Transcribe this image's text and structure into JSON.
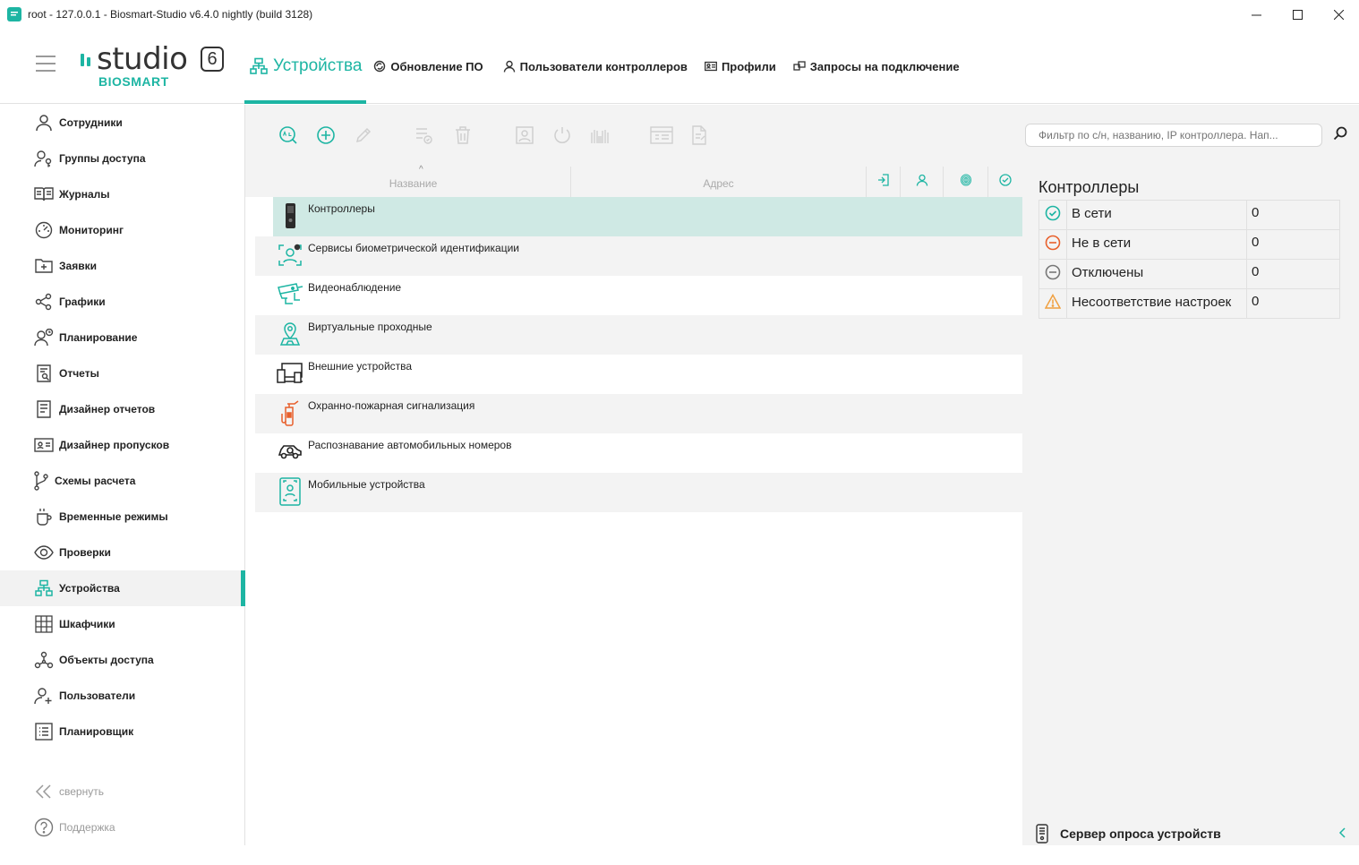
{
  "window": {
    "title": "root - 127.0.0.1 - Biosmart-Studio v6.4.0 nightly (build 3128)",
    "minimize": "—",
    "maximize": "☐",
    "close": "✕"
  },
  "logo": {
    "word": "studio",
    "number": "6",
    "brand": "BIOSMART"
  },
  "topnav": {
    "tabs": [
      {
        "label": "Устройства",
        "icon": "devices-icon",
        "active": true
      },
      {
        "label": "Обновление ПО",
        "icon": "update-icon"
      },
      {
        "label": "Пользователи контроллеров",
        "icon": "user-icon"
      },
      {
        "label": "Профили",
        "icon": "id-card-icon"
      },
      {
        "label": "Запросы на подключение",
        "icon": "link-icon"
      }
    ]
  },
  "sidebar": {
    "items": [
      {
        "label": "Сотрудники",
        "icon": "person-icon"
      },
      {
        "label": "Группы доступа",
        "icon": "group-access-icon"
      },
      {
        "label": "Журналы",
        "icon": "book-icon"
      },
      {
        "label": "Мониторинг",
        "icon": "gauge-icon"
      },
      {
        "label": "Заявки",
        "icon": "folder-plus-icon"
      },
      {
        "label": "Графики",
        "icon": "share-icon"
      },
      {
        "label": "Планирование",
        "icon": "person-clock-icon"
      },
      {
        "label": "Отчеты",
        "icon": "report-icon"
      },
      {
        "label": "Дизайнер отчетов",
        "icon": "report-designer-icon"
      },
      {
        "label": "Дизайнер пропусков",
        "icon": "badge-designer-icon"
      },
      {
        "label": "Схемы расчета",
        "icon": "branch-icon"
      },
      {
        "label": "Временные режимы",
        "icon": "cup-icon"
      },
      {
        "label": "Проверки",
        "icon": "eye-icon"
      },
      {
        "label": "Устройства",
        "icon": "devices-icon",
        "active": true
      },
      {
        "label": "Шкафчики",
        "icon": "lockers-icon"
      },
      {
        "label": "Объекты доступа",
        "icon": "nodes-icon"
      },
      {
        "label": "Пользователи",
        "icon": "user-add-icon"
      },
      {
        "label": "Планировщик",
        "icon": "list-icon"
      }
    ],
    "collapse": "свернуть",
    "support": "Поддержка"
  },
  "table": {
    "col_name": "Название",
    "col_address": "Адрес",
    "sort_glyph": "^",
    "rows": [
      {
        "label": "Контроллеры",
        "icon": "controller-icon"
      },
      {
        "label": "Сервисы биометрической идентификации",
        "icon": "face-recognition-icon"
      },
      {
        "label": "Видеонаблюдение",
        "icon": "cctv-icon"
      },
      {
        "label": "Виртуальные проходные",
        "icon": "virtual-checkpoint-icon"
      },
      {
        "label": "Внешние устройства",
        "icon": "external-devices-icon"
      },
      {
        "label": "Охранно-пожарная сигнализация",
        "icon": "fire-alarm-icon"
      },
      {
        "label": "Распознавание автомобильных номеров",
        "icon": "car-plate-icon"
      },
      {
        "label": "Мобильные устройства",
        "icon": "mobile-device-icon"
      }
    ]
  },
  "filter": {
    "placeholder": "Фильтр по с/н, названию, IP контроллера. Нап..."
  },
  "panel": {
    "title": "Контроллеры",
    "stats": [
      {
        "label": "В сети",
        "value": "0",
        "icon": "check-circle-icon",
        "color": "#1db5a3"
      },
      {
        "label": "Не в сети",
        "value": "0",
        "icon": "minus-circle-icon",
        "color": "#e8602c"
      },
      {
        "label": "Отключены",
        "value": "0",
        "icon": "minus-circle-gray-icon",
        "color": "#777777"
      },
      {
        "label": "Несоответствие настроек",
        "value": "0",
        "icon": "warning-icon",
        "color": "#f0a040"
      }
    ],
    "server": "Сервер опроса устройств"
  },
  "colors": {
    "accent": "#1db5a3",
    "selected_row": "#cfe9e4",
    "panel_bg": "#f3f3f3"
  }
}
